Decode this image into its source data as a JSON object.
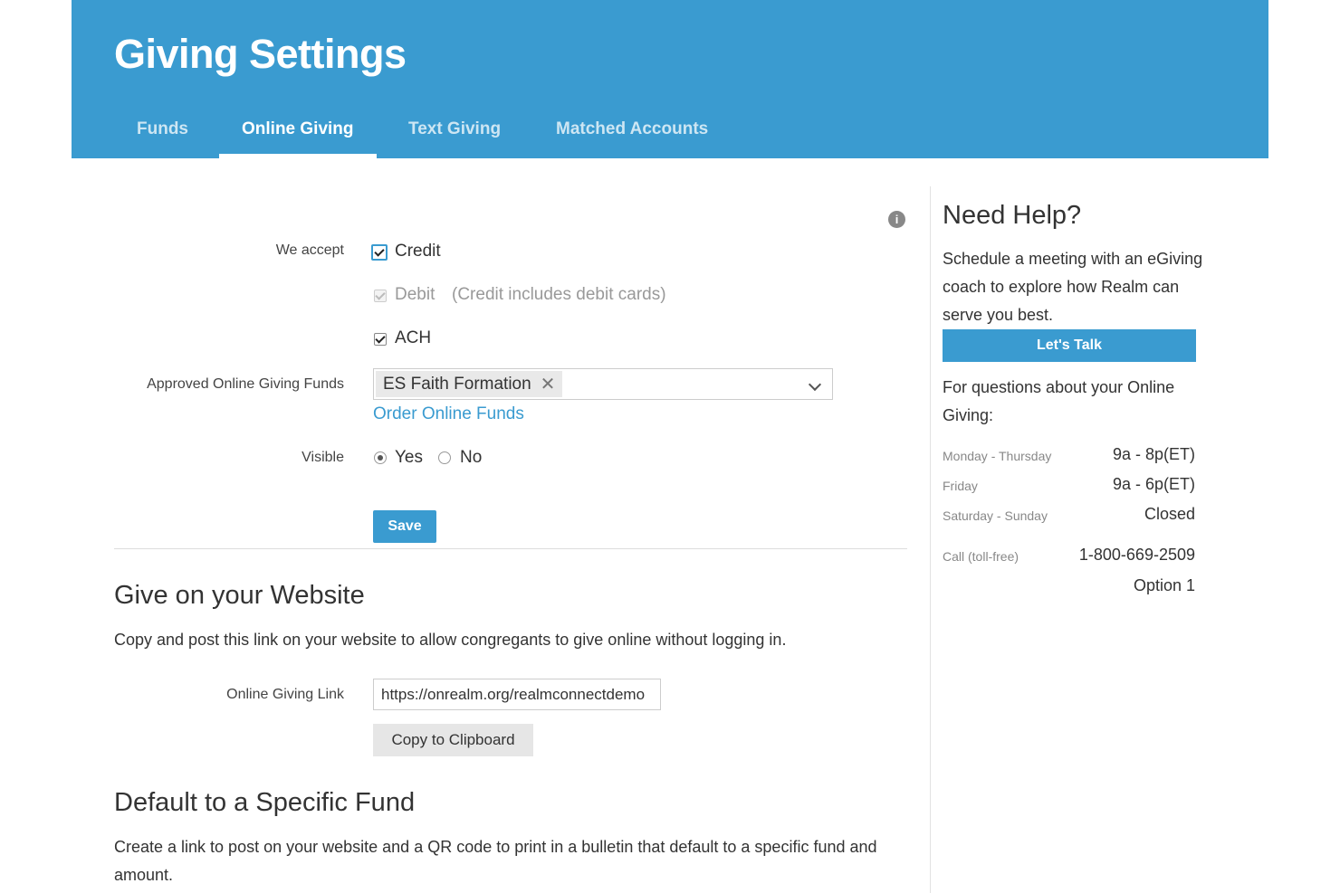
{
  "header": {
    "title": "Giving Settings",
    "tabs": [
      {
        "label": "Funds"
      },
      {
        "label": "Online Giving"
      },
      {
        "label": "Text Giving"
      },
      {
        "label": "Matched Accounts"
      }
    ]
  },
  "form": {
    "we_accept_label": "We accept",
    "credit_label": "Credit",
    "debit_label": "Debit",
    "debit_note": "(Credit includes debit cards)",
    "ach_label": "ACH",
    "funds_label": "Approved Online Giving Funds",
    "selected_fund": "ES Faith Formation",
    "remove_glyph": "✕",
    "order_link": "Order Online Funds",
    "visible_label": "Visible",
    "yes_label": "Yes",
    "no_label": "No",
    "save_label": "Save"
  },
  "website": {
    "heading": "Give on your Website",
    "description": "Copy and post this link on your website to allow congregants to give online without logging in.",
    "link_label": "Online Giving Link",
    "link_value": "https://onrealm.org/realmconnectdemo",
    "copy_label": "Copy to Clipboard"
  },
  "specific_fund": {
    "heading": "Default to a Specific Fund",
    "description": "Create a link to post on your website and a QR code to print in a bulletin that default to a specific fund and amount."
  },
  "help": {
    "title": "Need Help?",
    "text": "Schedule a meeting with an eGiving coach to explore how Realm can serve you best.",
    "button": "Let's Talk",
    "questions": "For questions about your Online Giving:",
    "schedule": [
      {
        "days": "Monday - Thursday",
        "hours": "9a - 8p(ET)"
      },
      {
        "days": "Friday",
        "hours": "9a - 6p(ET)"
      },
      {
        "days": "Saturday - Sunday",
        "hours": "Closed"
      }
    ],
    "call_label": "Call (toll-free)",
    "phone": "1-800-669-2509",
    "option": "Option 1"
  },
  "icons": {
    "info": "info-icon",
    "chevron": "chevron-down-icon",
    "remove": "close-icon"
  },
  "colors": {
    "accent": "#3a9bd0"
  }
}
